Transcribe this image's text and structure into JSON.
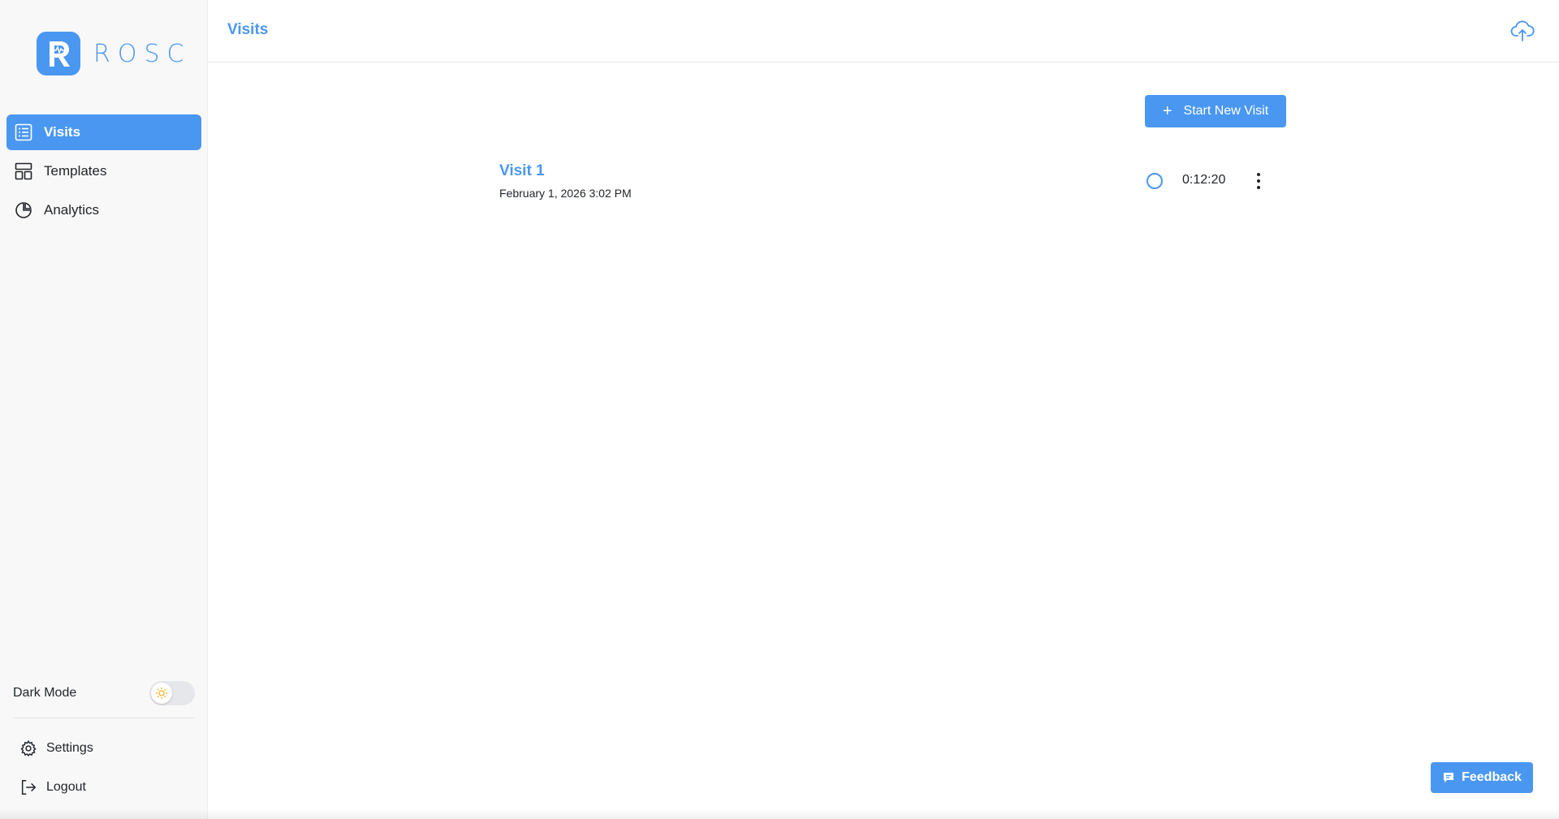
{
  "brand": {
    "name": "ROSC",
    "logo_letter": "R",
    "accent": "#4a97f2"
  },
  "sidebar": {
    "items": [
      {
        "label": "Visits",
        "icon": "list-icon",
        "active": true
      },
      {
        "label": "Templates",
        "icon": "layout-icon",
        "active": false
      },
      {
        "label": "Analytics",
        "icon": "pie-chart-icon",
        "active": false
      }
    ],
    "dark_mode": {
      "label": "Dark Mode",
      "enabled": false,
      "icon": "sun-icon"
    },
    "bottom": [
      {
        "label": "Settings",
        "icon": "gear-icon"
      },
      {
        "label": "Logout",
        "icon": "logout-icon"
      }
    ]
  },
  "header": {
    "title": "Visits",
    "upload_icon": "cloud-upload-icon"
  },
  "main": {
    "start_button": {
      "label": "Start New Visit",
      "icon": "plus-icon"
    },
    "visits": [
      {
        "title": "Visit 1",
        "date": "February 1, 2026 3:02 PM",
        "duration": "0:12:20"
      }
    ]
  },
  "feedback": {
    "label": "Feedback",
    "icon": "message-icon"
  }
}
